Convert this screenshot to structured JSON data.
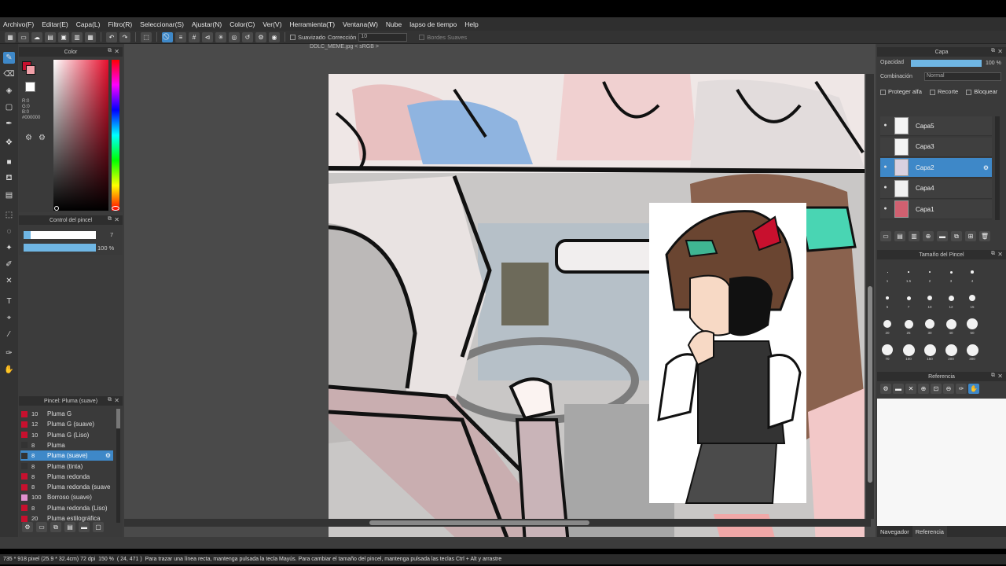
{
  "menu": [
    "Archivo(F)",
    "Editar(E)",
    "Capa(L)",
    "Filtro(R)",
    "Seleccionar(S)",
    "Ajustar(N)",
    "Color(C)",
    "Ver(V)",
    "Herramienta(T)",
    "Ventana(W)",
    "Nube",
    "lapso de tiempo",
    "Help"
  ],
  "toolbar": {
    "smoothing_label": "Suavizado",
    "correction_label": "Corrección",
    "correction_value": "10",
    "soft_edges_label": "Bordes Suaves"
  },
  "document": {
    "title": "DDLC_MEME.jpg < sRGB >"
  },
  "color_panel": {
    "title": "Color",
    "r_label": "R:0",
    "g_label": "G:0",
    "b_label": "B:0",
    "hex": "#000000",
    "fg_color": "#c8102e",
    "bg_color": "#ffffff",
    "hue_color": "#e8102e"
  },
  "brush_control": {
    "title": "Control del pincel",
    "size": "7",
    "opacity": "100 %"
  },
  "brush_list": {
    "title": "Pincel: Pluma (suave)",
    "items": [
      {
        "size": "10",
        "name": "Pluma G",
        "color": "#c8102e"
      },
      {
        "size": "12",
        "name": "Pluma G (suave)",
        "color": "#c8102e"
      },
      {
        "size": "10",
        "name": "Pluma G (Liso)",
        "color": "#c8102e"
      },
      {
        "size": "8",
        "name": "Pluma",
        "color": "#333333"
      },
      {
        "size": "8",
        "name": "Pluma (suave)",
        "color": "#333333"
      },
      {
        "size": "8",
        "name": "Pluma (tinta)",
        "color": "#333333"
      },
      {
        "size": "8",
        "name": "Pluma redonda",
        "color": "#c8102e"
      },
      {
        "size": "8",
        "name": "Pluma redonda (suave",
        "color": "#c8102e"
      },
      {
        "size": "100",
        "name": "Borroso (suave)",
        "color": "#e090d0"
      },
      {
        "size": "8",
        "name": "Pluma redonda (Liso)",
        "color": "#c8102e"
      },
      {
        "size": "20",
        "name": "Pluma estilográfica",
        "color": "#c8102e"
      }
    ]
  },
  "layer_panel": {
    "title": "Capa",
    "opacity_label": "Opacidad",
    "opacity_value": "100 %",
    "opacity_fraction": 1.0,
    "blend_label": "Combinación",
    "blend_value": "Normal",
    "protect_alpha": "Proteger alfa",
    "clipping": "Recorte",
    "lock": "Bloquear",
    "layers": [
      {
        "name": "Capa5",
        "visible": true
      },
      {
        "name": "Capa3",
        "visible": false
      },
      {
        "name": "Capa2",
        "visible": true
      },
      {
        "name": "Capa4",
        "visible": true
      },
      {
        "name": "Capa1",
        "visible": true
      }
    ]
  },
  "brush_size_panel": {
    "title": "Tamaño del Pincel",
    "sizes": [
      "1",
      "1.5",
      "2",
      "3",
      "4",
      "5",
      "7",
      "10",
      "12",
      "15",
      "20",
      "25",
      "30",
      "40",
      "50",
      "70",
      "100",
      "150",
      "200",
      "300"
    ]
  },
  "reference_panel": {
    "title": "Referencia"
  },
  "bottom_tabs": [
    "Navegador",
    "Referencia"
  ],
  "status": {
    "dims": "735 * 918 pixel",
    "physical": "(25.9 * 32.4cm)",
    "dpi": "72 dpi",
    "zoom": "150 %",
    "cursor": "( 24, 471 )",
    "hint": "Para trazar una línea recta, mantenga pulsada la tecla Mayús. Para cambiar el tamaño del pincel, mantenga pulsada las teclas Ctrl + Alt y arrastre"
  }
}
